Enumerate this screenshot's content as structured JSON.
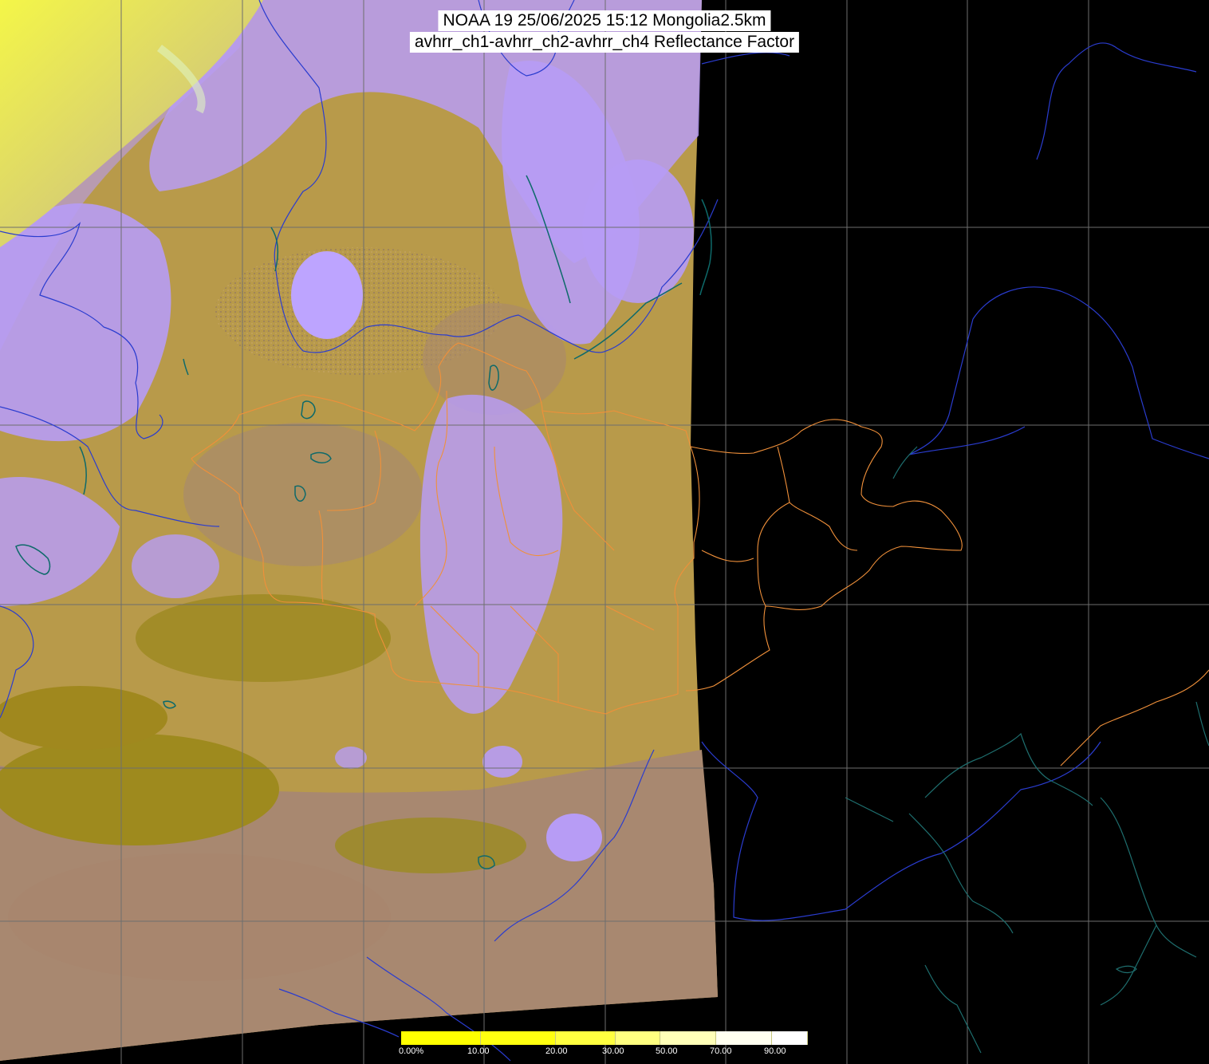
{
  "title": {
    "line1": "NOAA 19 25/06/2025 15:12 Mongolia2.5km",
    "line2": "avhrr_ch1-avhrr_ch2-avhrr_ch4 Reflectance Factor"
  },
  "colorbar": {
    "ticks": [
      "0.00%",
      "10.00",
      "20.00",
      "30.00",
      "50.00",
      "70.00",
      "90.00"
    ],
    "colors": [
      "#ffff00",
      "#ffff10",
      "#ffff40",
      "#ffff80",
      "#ffffb8",
      "#fffff0",
      "#ffffff"
    ]
  },
  "map": {
    "colors": {
      "background": "#000000",
      "land_tan": "#b89a4a",
      "land_brown": "#a88870",
      "land_olive": "#9e8a1e",
      "cloud_lavender": "#b79cf5",
      "haze_yellow": "#f2f050",
      "grid": "#6e6e6e",
      "border_blue": "#2a3ccf",
      "border_orange": "#f0903a",
      "coast_teal": "#1e6e6e",
      "lake_teal": "#0e6a6a"
    }
  }
}
